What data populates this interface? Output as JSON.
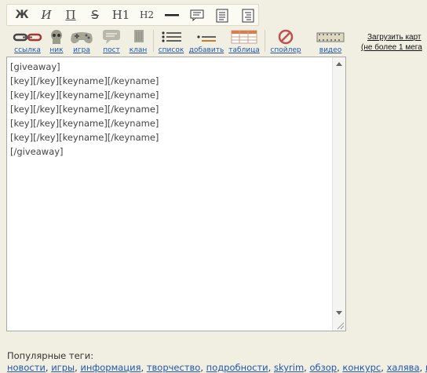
{
  "format_toolbar": {
    "bold": "Ж",
    "italic": "И",
    "underline": "П",
    "strike": "S",
    "h1": "H1",
    "h2": "H2",
    "icons": [
      "horizontal-rule-icon",
      "quote-icon",
      "align-left-icon",
      "align-right-icon"
    ]
  },
  "insert_toolbar": [
    {
      "label": "ссылка",
      "icon": "chain-link-icon"
    },
    {
      "label": "ник",
      "icon": "skull-icon"
    },
    {
      "label": "игра",
      "icon": "gamepad-icon"
    },
    {
      "label": "пост",
      "icon": "speech-bubble-icon"
    },
    {
      "label": "клан",
      "icon": "flag-icon"
    },
    {
      "label": "список",
      "icon": "list-icon"
    },
    {
      "label": "добавить",
      "icon": "add-list-icon"
    },
    {
      "label": "таблица",
      "icon": "table-icon"
    },
    {
      "label": "спойлер",
      "icon": "no-entry-icon"
    },
    {
      "label": "видео",
      "icon": "film-icon"
    }
  ],
  "upload": {
    "line1": "Загрузить карт",
    "line2": "(не более 1 мега"
  },
  "editor": {
    "content": "[giveaway]\n[key][/key][keyname][/keyname]\n[key][/key][keyname][/keyname]\n[key][/key][keyname][/keyname]\n[key][/key][keyname][/keyname]\n[key][/key][keyname][/keyname]\n[/giveaway]"
  },
  "popular_tags": {
    "label": "Популярные теги:",
    "tags": [
      "новости",
      "игры",
      "информация",
      "творчество",
      "подробности",
      "skyrim",
      "обзор",
      "конкурс",
      "халява",
      "ви"
    ]
  },
  "colors": {
    "background": "#f1efe2",
    "link": "#2255aa",
    "spoiler_accent": "#c0504d"
  }
}
